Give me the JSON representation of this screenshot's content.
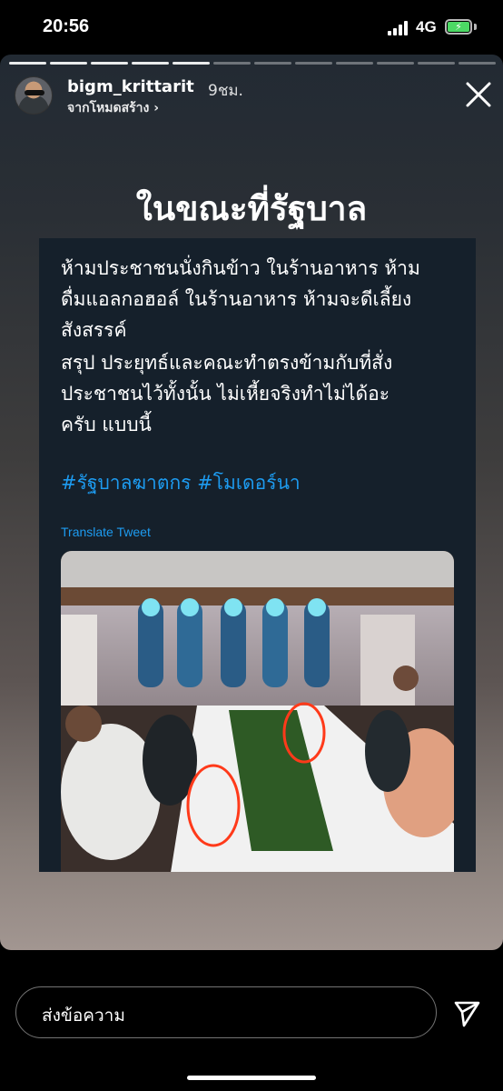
{
  "status_bar": {
    "time": "20:56",
    "network": "4G",
    "battery_level": 1.0,
    "icons": [
      "signal-icon",
      "battery-charging-icon"
    ]
  },
  "story": {
    "segments_total": 12,
    "segments_viewed": 5,
    "username": "bigm_krittarit",
    "time_ago": "9ชม.",
    "subline": "จากโหมดสร้าง ›",
    "headline": "ในขณะที่รัฐบาล",
    "colors": {
      "background_top": "#222a33",
      "background_bottom": "#a29691"
    }
  },
  "tweet": {
    "paragraph1_lines": [
      "ห้ามประชาชนนั่งกินข้าว ในร้านอาหาร ห้าม",
      "ดื่มแอลกอฮอล์ ในร้านอาหาร ห้ามจะดีเลี้ยง",
      "สังสรรค์"
    ],
    "paragraph2_lines": [
      "สรุป ประยุทธ์และคณะทำตรงข้ามกับที่สั่ง",
      "ประชาชนไว้ทั้งนั้น ไม่เหี้ยจริงทำไม่ได้อะ",
      "ครับ แบบนี้"
    ],
    "hashtags": "#รัฐบาลฆาตกร #โมเดอร์นา",
    "translate_label": "Translate Tweet",
    "colors": {
      "background": "#15202b",
      "link": "#1d9bf0"
    },
    "photo_description_icons": [
      "banquet-photo"
    ]
  },
  "composer": {
    "placeholder": "ส่งข้อความ",
    "send_icon": "send-icon"
  }
}
